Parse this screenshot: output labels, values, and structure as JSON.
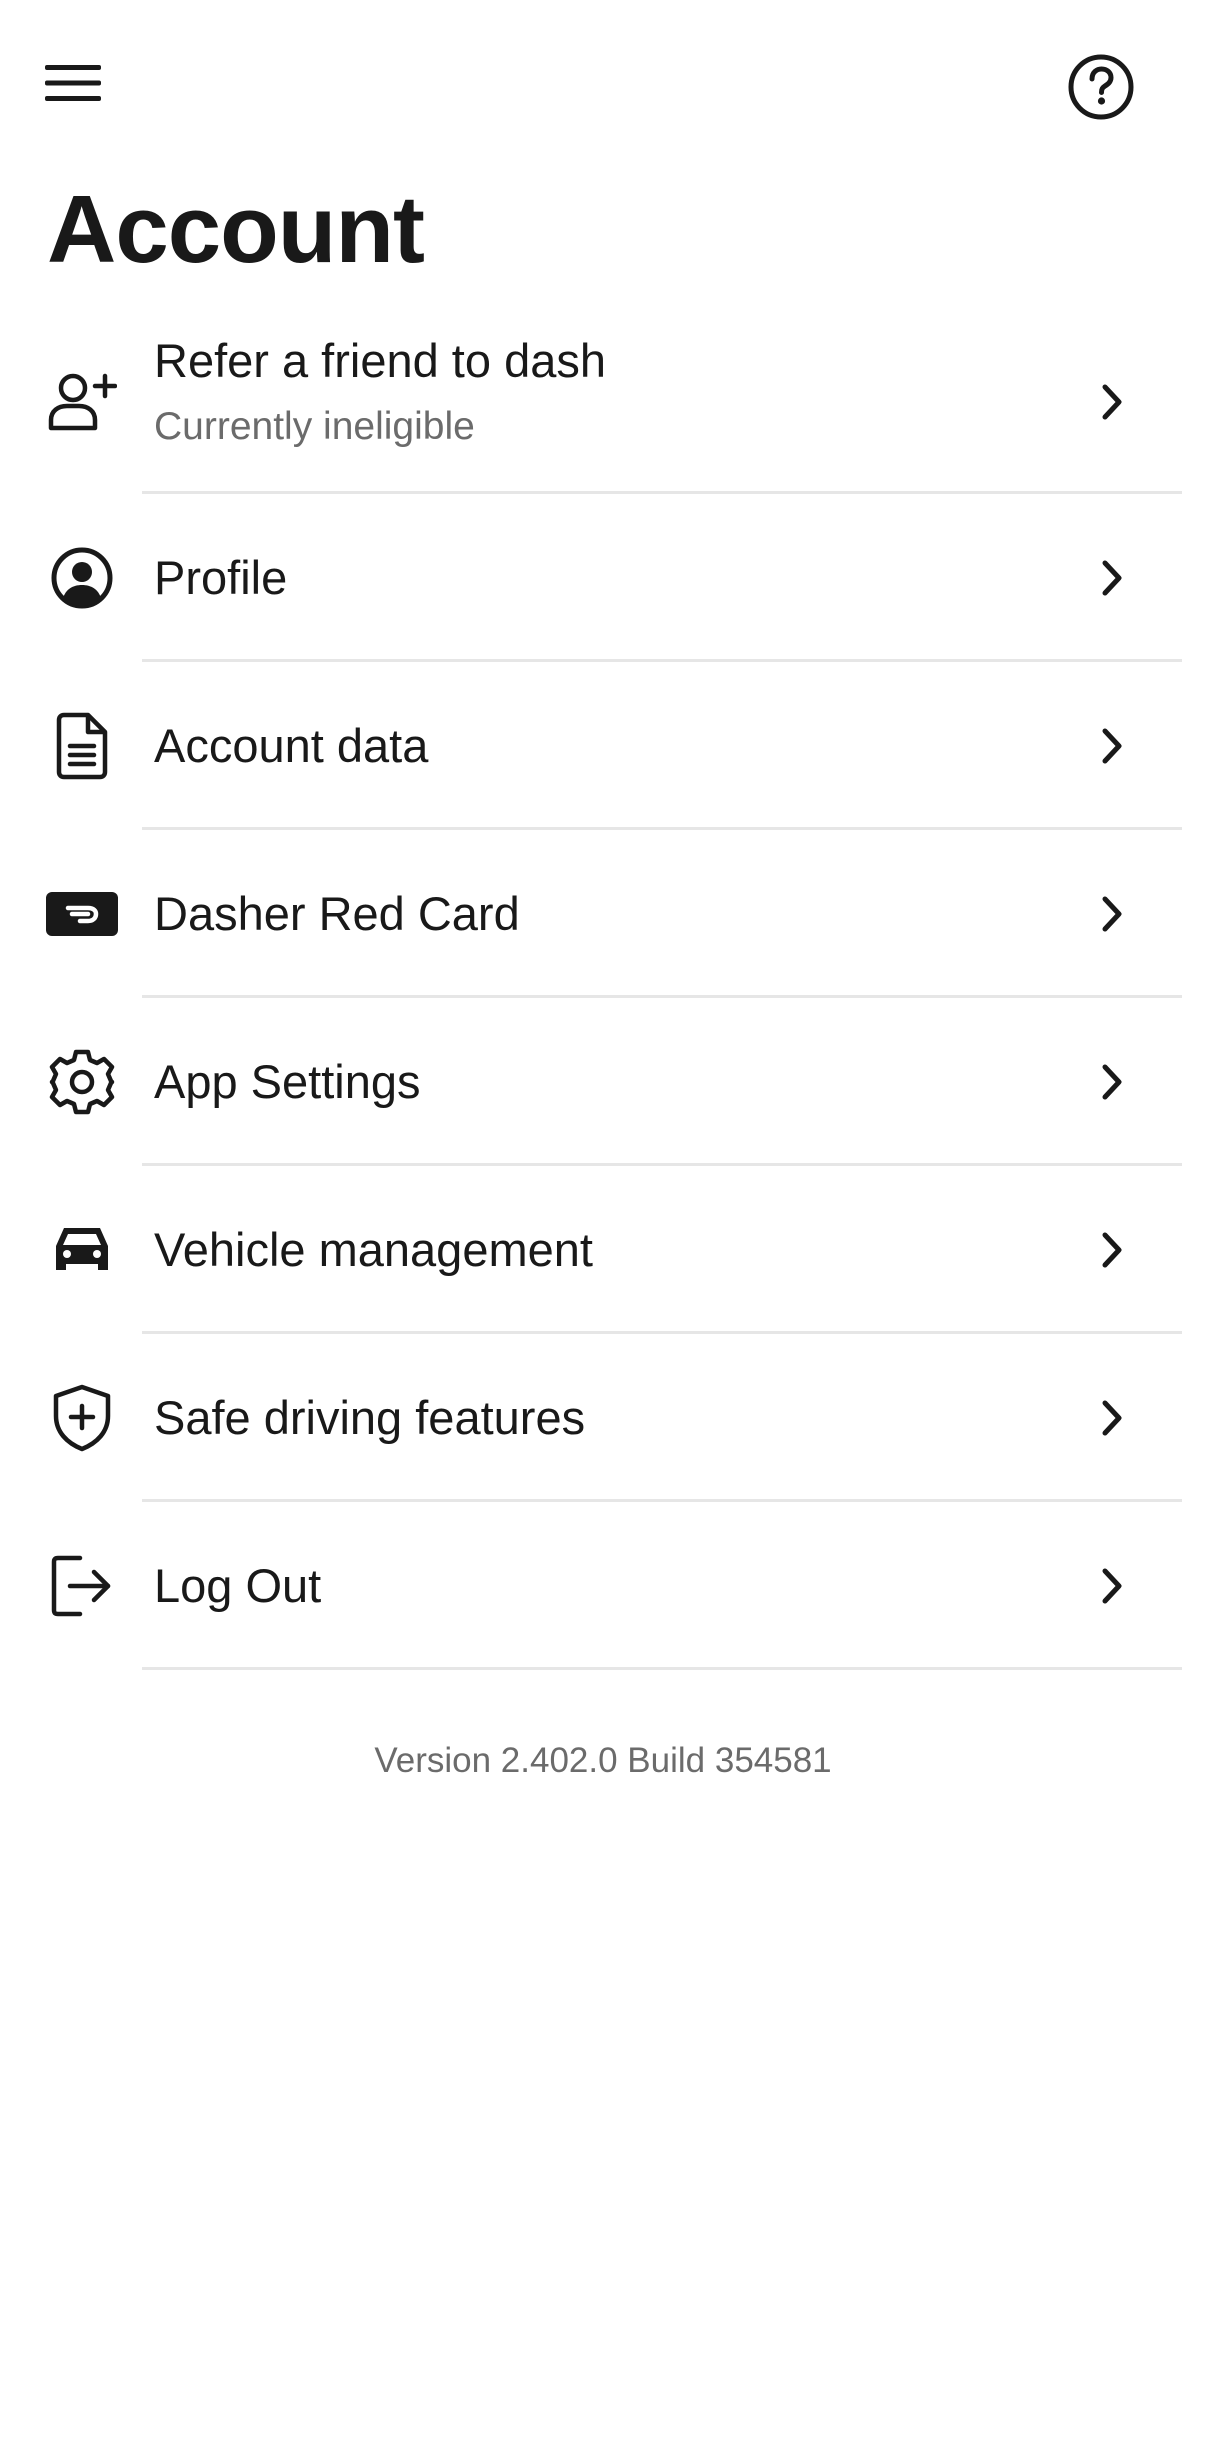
{
  "header": {
    "menu_icon": "hamburger-menu-icon",
    "help_icon": "question-circle-icon",
    "title": "Account"
  },
  "menu": [
    {
      "id": "refer",
      "icon": "person-add-icon",
      "label": "Refer a friend to dash",
      "sublabel": "Currently ineligible"
    },
    {
      "id": "profile",
      "icon": "user-circle-icon",
      "label": "Profile"
    },
    {
      "id": "account-data",
      "icon": "document-icon",
      "label": "Account data"
    },
    {
      "id": "red-card",
      "icon": "red-card-icon",
      "label": "Dasher Red Card"
    },
    {
      "id": "app-settings",
      "icon": "gear-icon",
      "label": "App Settings"
    },
    {
      "id": "vehicle",
      "icon": "car-icon",
      "label": "Vehicle management"
    },
    {
      "id": "safe-driving",
      "icon": "shield-plus-icon",
      "label": "Safe driving features"
    },
    {
      "id": "logout",
      "icon": "logout-icon",
      "label": "Log Out"
    }
  ],
  "footer": {
    "version": "Version 2.402.0 Build 354581"
  },
  "colors": {
    "text": "#191919",
    "secondary_text": "#6b6b6b",
    "divider": "#e6e6e6",
    "background": "#ffffff"
  }
}
